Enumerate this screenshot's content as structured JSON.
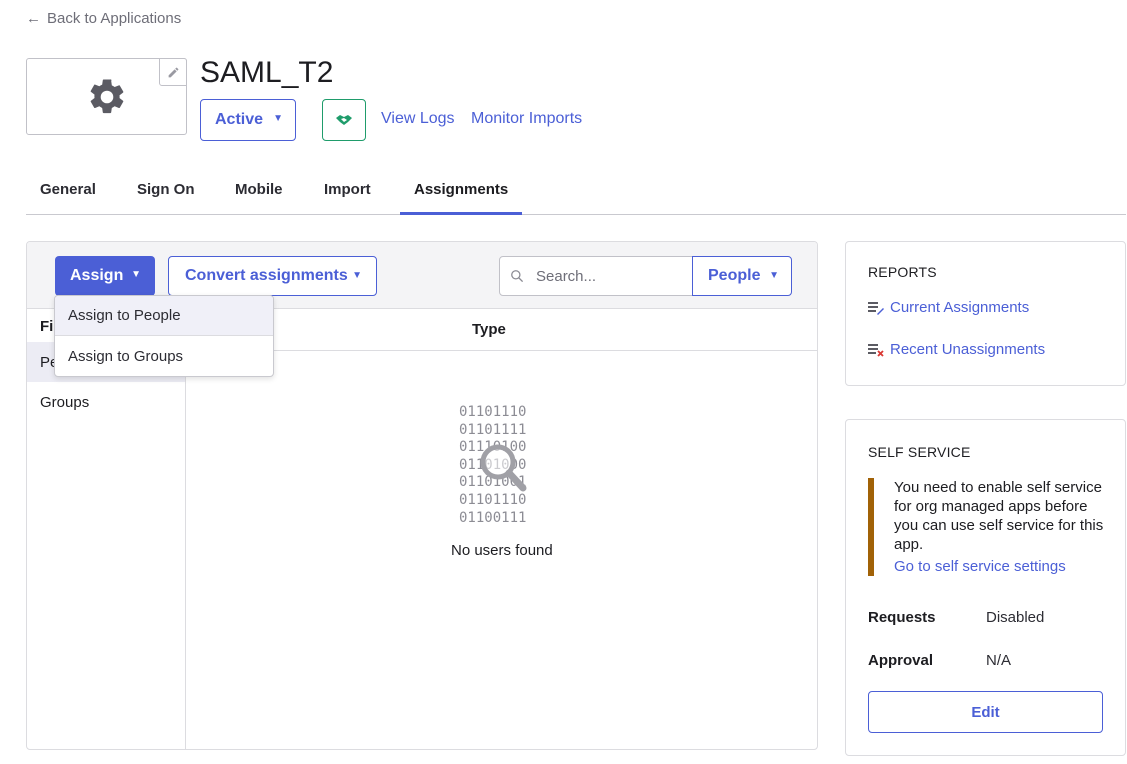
{
  "back_link": {
    "label": "Back to Applications"
  },
  "app": {
    "title": "SAML_T2",
    "status": "Active",
    "links": {
      "view_logs": "View Logs",
      "monitor_imports": "Monitor Imports"
    }
  },
  "tabs": [
    {
      "label": "General"
    },
    {
      "label": "Sign On"
    },
    {
      "label": "Mobile"
    },
    {
      "label": "Import"
    },
    {
      "label": "Assignments",
      "active": true
    }
  ],
  "toolbar": {
    "assign_label": "Assign",
    "convert_label": "Convert assignments",
    "search_placeholder": "Search...",
    "filter_type": "People"
  },
  "assign_menu": {
    "items": [
      {
        "label": "Assign to People"
      },
      {
        "label": "Assign to Groups"
      }
    ]
  },
  "filters": {
    "header": "Fil",
    "items": [
      {
        "label": "Pe",
        "selected": true
      },
      {
        "label": "Groups"
      }
    ]
  },
  "table": {
    "column": "Type",
    "empty_binary": "01101110\n01101111\n01110100\n01101000\n01101001\n01101110\n01100111",
    "empty_text": "No users found"
  },
  "reports": {
    "title": "REPORTS",
    "items": [
      {
        "label": "Current Assignments"
      },
      {
        "label": "Recent Unassignments"
      }
    ]
  },
  "self_service": {
    "title": "SELF SERVICE",
    "notice": "You need to enable self service for org managed apps before you can use self service for this app.",
    "notice_link": "Go to self service settings",
    "requests_label": "Requests",
    "requests_value": "Disabled",
    "approval_label": "Approval",
    "approval_value": "N/A",
    "edit_label": "Edit"
  },
  "colors": {
    "accent": "#4b5fd6",
    "success": "#1f9c6b",
    "notice_bar": "#a16207"
  }
}
